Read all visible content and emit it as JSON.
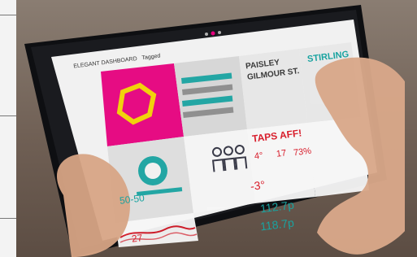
{
  "app": {
    "header": "ELEGANT DASHBOARD",
    "header_sub": "Tagged",
    "page_dots": [
      "inactive",
      "active",
      "inactive"
    ]
  },
  "tiles": {
    "address": {
      "title": "PAISLEY",
      "subtitle": "GILMOUR ST."
    },
    "rail": {
      "title": "STIRLING"
    },
    "news": {
      "headline": "TAPS AFF!"
    },
    "weather": {
      "temp_c": "-3°",
      "temp_alt": "4°",
      "value_17": "17",
      "humidity": "73%"
    },
    "ratio": {
      "value": "50-50"
    },
    "prices": {
      "value1": "112.7p",
      "value2": "118.7p"
    },
    "chart": {
      "value": "27"
    }
  },
  "colors": {
    "accent_magenta": "#e6007e",
    "accent_teal": "#19a3a0",
    "accent_yellow": "#f2d100",
    "accent_red": "#d81d2b",
    "text_gray": "#6d6d6d"
  }
}
